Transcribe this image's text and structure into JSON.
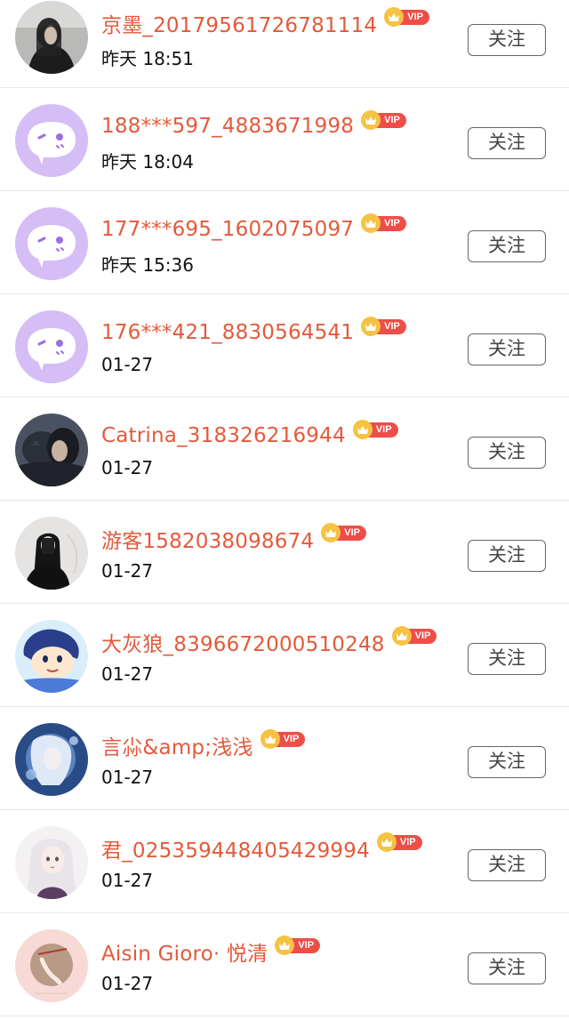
{
  "follow_label": "关注",
  "vip_label": "VIP",
  "colors": {
    "name": "#e4593b",
    "vip_tag": "#ee4e47",
    "vip_crown": "#f6c243",
    "default_avatar_bg": "#d4bef5"
  },
  "users": [
    {
      "name": "京墨_20179561726781114",
      "time": "昨天 18:51",
      "avatar": "photo-dark-girl"
    },
    {
      "name": "188***597_4883671998",
      "time": "昨天 18:04",
      "avatar": "default-chat-bubble"
    },
    {
      "name": "177***695_1602075097",
      "time": "昨天 15:36",
      "avatar": "default-chat-bubble"
    },
    {
      "name": "176***421_8830564541",
      "time": "01-27",
      "avatar": "default-chat-bubble"
    },
    {
      "name": "Catrina_318326216944",
      "time": "01-27",
      "avatar": "photo-girl-with-cat"
    },
    {
      "name": "游客1582038098674",
      "time": "01-27",
      "avatar": "photo-mirror-selfie"
    },
    {
      "name": "大灰狼_8396672000510248",
      "time": "01-27",
      "avatar": "cartoon-boy"
    },
    {
      "name": "言尛&amp;浅浅",
      "time": "01-27",
      "avatar": "anime-blue-girl"
    },
    {
      "name": "君_025359448405429994",
      "time": "01-27",
      "avatar": "anime-white-hair"
    },
    {
      "name": "Aisin Gioro· 悦清",
      "time": "01-27",
      "avatar": "pink-hand-art"
    }
  ]
}
